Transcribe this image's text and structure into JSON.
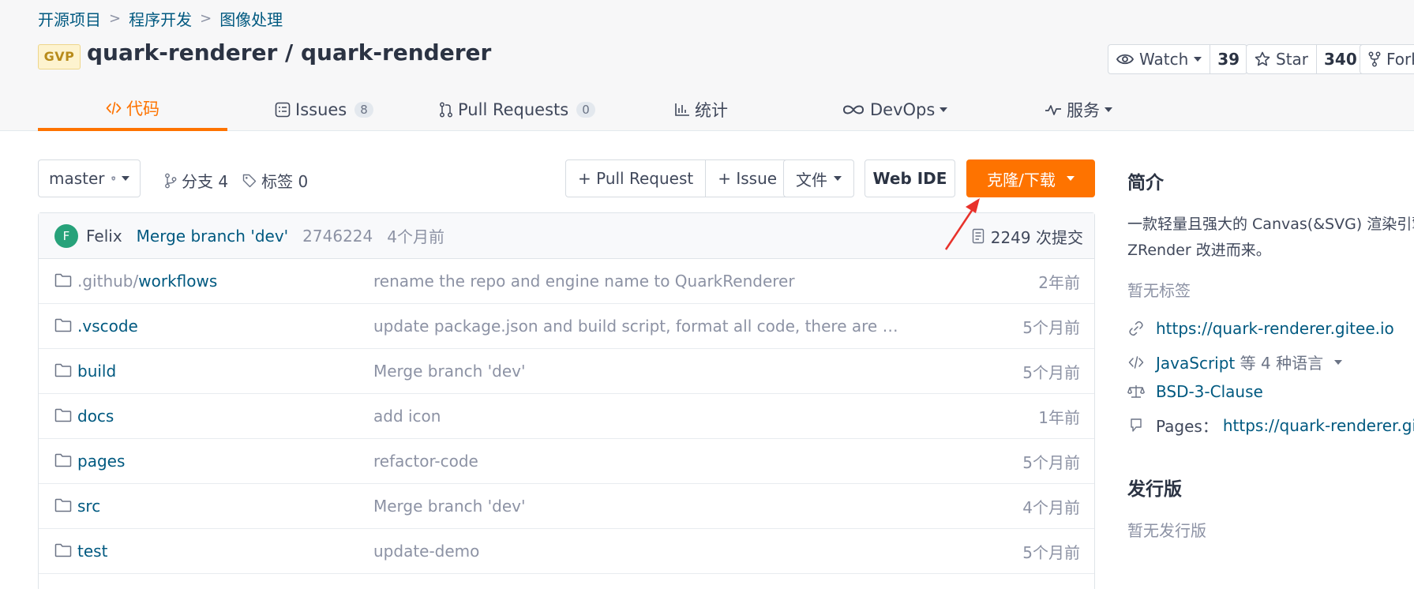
{
  "breadcrumb": [
    "开源项目",
    "程序开发",
    "图像处理"
  ],
  "breadcrumb_sep": ">",
  "repo": {
    "badge": "GVP",
    "title": "quark-renderer / quark-renderer"
  },
  "header_buttons": {
    "watch": {
      "label": "Watch",
      "count": "39"
    },
    "star": {
      "label": "Star",
      "count": "340"
    },
    "fork": {
      "label": "Fork"
    }
  },
  "tabs": [
    {
      "label": "代码",
      "active": true,
      "icon": "code-icon"
    },
    {
      "label": "Issues",
      "badge": "8",
      "icon": "issues-icon"
    },
    {
      "label": "Pull Requests",
      "badge": "0",
      "icon": "pull-request-icon"
    },
    {
      "label": "统计",
      "icon": "stats-icon"
    },
    {
      "label": "DevOps",
      "icon": "infinity-icon"
    },
    {
      "label": "服务",
      "icon": "pulse-icon"
    }
  ],
  "toolbar": {
    "branch": "master",
    "branches_label": "分支 4",
    "tags_label": "标签 0",
    "pull_request": "+ Pull Request",
    "issue": "+ Issue",
    "file": "文件",
    "web_ide": "Web IDE",
    "clone": "克隆/下载"
  },
  "last_commit": {
    "avatar_letter": "F",
    "author": "Felix",
    "message": "Merge branch 'dev'",
    "sha": "2746224",
    "time": "4个月前",
    "commit_count": "2249 次提交"
  },
  "files": [
    {
      "name_prefix": ".github/",
      "name": "workflows",
      "message": "rename the repo and engine name to QuarkRenderer",
      "time": "2年前"
    },
    {
      "name_prefix": "",
      "name": ".vscode",
      "message": "update package.json and build script, format all code, there are no ot...",
      "time": "5个月前"
    },
    {
      "name_prefix": "",
      "name": "build",
      "message": "Merge branch 'dev'",
      "time": "5个月前"
    },
    {
      "name_prefix": "",
      "name": "docs",
      "message": "add icon",
      "time": "1年前"
    },
    {
      "name_prefix": "",
      "name": "pages",
      "message": "refactor-code",
      "time": "5个月前"
    },
    {
      "name_prefix": "",
      "name": "src",
      "message": "Merge branch 'dev'",
      "time": "4个月前"
    },
    {
      "name_prefix": "",
      "name": "test",
      "message": "update-demo",
      "time": "5个月前"
    }
  ],
  "sidebar": {
    "intro_title": "简介",
    "description": "一款轻量且强大的 Canvas(&SVG) 渲染引擎，从 ZRender 改进而来。",
    "no_tags": "暂无标签",
    "website": "https://quark-renderer.gitee.io",
    "language_link": "JavaScript",
    "language_rest": "等 4 种语言",
    "license": "BSD-3-Clause",
    "pages_label": "Pages：",
    "pages_url": "https://quark-renderer.gitee.io",
    "releases_title": "发行版",
    "no_releases": "暂无发行版"
  },
  "colors": {
    "accent": "#fe7300",
    "link": "#005980",
    "annotation_arrow": "#e8322b"
  }
}
